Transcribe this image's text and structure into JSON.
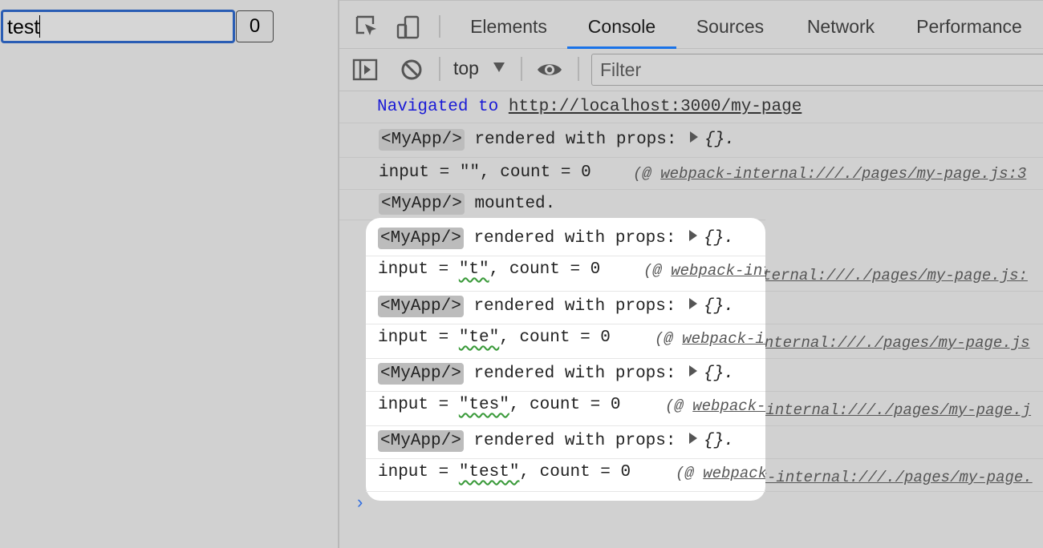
{
  "page": {
    "input_value": "test",
    "count_button": "0"
  },
  "devtools": {
    "tabs": [
      {
        "label": "Elements"
      },
      {
        "label": "Console"
      },
      {
        "label": "Sources"
      },
      {
        "label": "Network"
      },
      {
        "label": "Performance"
      }
    ],
    "active_tab": "Console",
    "context": "top",
    "filter_placeholder": "Filter",
    "accent_color": "#1a73e8"
  },
  "console": {
    "navigated_text": "Navigated to",
    "navigated_url": "http://localhost:3000/my-page",
    "tag": "<MyApp/>",
    "rendered_text": "rendered with props:",
    "props": "{}.",
    "mounted_text": "mounted.",
    "logs": [
      {
        "input": "\"\"",
        "rest": ", count = 0",
        "src_prefix": "(@ ",
        "src": "webpack-internal:///./pages/my-page.js:3"
      },
      {
        "input": "\"t\"",
        "rest": ", count = 0",
        "src_prefix": "(@ ",
        "src": "webpack-internal:///./pages/my-page.js:"
      },
      {
        "input": "\"te\"",
        "rest": ", count = 0",
        "src_prefix": "(@ ",
        "src": "webpack-internal:///./pages/my-page.js"
      },
      {
        "input": "\"tes\"",
        "rest": ", count = 0",
        "src_prefix": "(@ ",
        "src": "webpack-internal:///./pages/my-page.j"
      },
      {
        "input": "\"test\"",
        "rest": ", count = 0",
        "src_prefix": "(@ ",
        "src": "webpack-internal:///./pages/my-page."
      }
    ],
    "input_prefix": "input = ",
    "prompt": "›"
  }
}
